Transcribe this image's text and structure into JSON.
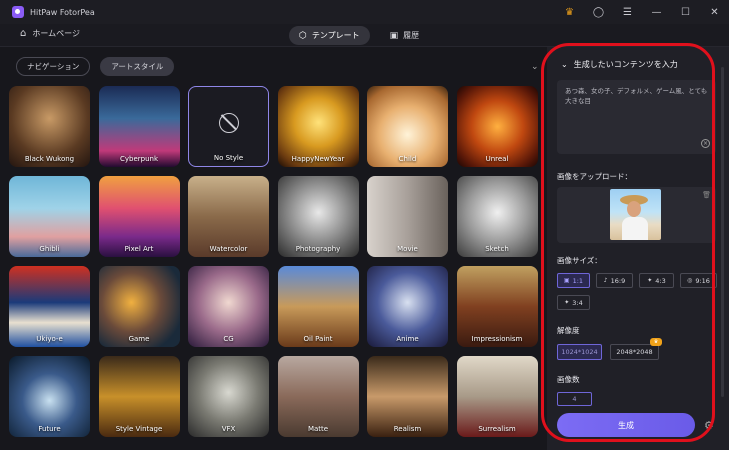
{
  "app": {
    "title": "HitPaw FotorPea"
  },
  "titlebar": {
    "icons": [
      "crown-icon",
      "user-icon",
      "menu-icon",
      "minimize-icon",
      "maximize-icon",
      "close-icon"
    ]
  },
  "nav": {
    "home_label": "ホームページ",
    "tabs": [
      {
        "label": "テンプレート",
        "icon": "cube-icon",
        "active": true
      },
      {
        "label": "履歴",
        "icon": "history-icon",
        "active": false
      }
    ]
  },
  "filters": [
    {
      "label": "ナビゲーション",
      "active": false
    },
    {
      "label": "アートスタイル",
      "active": true
    }
  ],
  "styles": [
    {
      "label": "Black Wukong"
    },
    {
      "label": "Cyberpunk"
    },
    {
      "label": "No Style"
    },
    {
      "label": "HappyNewYear"
    },
    {
      "label": "Child"
    },
    {
      "label": "Unreal"
    },
    {
      "label": "Ghibli"
    },
    {
      "label": "Pixel Art"
    },
    {
      "label": "Watercolor"
    },
    {
      "label": "Photography"
    },
    {
      "label": "Movie"
    },
    {
      "label": "Sketch"
    },
    {
      "label": "Ukiyo-e"
    },
    {
      "label": "Game"
    },
    {
      "label": "CG"
    },
    {
      "label": "Oil Paint"
    },
    {
      "label": "Anime"
    },
    {
      "label": "Impressionism"
    },
    {
      "label": "Future"
    },
    {
      "label": "Style Vintage"
    },
    {
      "label": "VFX"
    },
    {
      "label": "Matte"
    },
    {
      "label": "Realism"
    },
    {
      "label": "Surrealism"
    }
  ],
  "panel": {
    "header": "生成したいコンテンツを入力",
    "prompt_text": "あつ森、女の子、デフォルメ、ゲーム風、とても大きな目",
    "upload_label": "画像をアップロード：",
    "size_label": "画像サイズ：",
    "sizes": [
      {
        "label": "1:1",
        "active": true
      },
      {
        "label": "16:9",
        "active": false
      },
      {
        "label": "4:3",
        "active": false
      },
      {
        "label": "9:16",
        "active": false
      },
      {
        "label": "3:4",
        "active": false
      }
    ],
    "resolution_label": "解像度",
    "resolutions": [
      {
        "label": "1024*1024",
        "active": true
      },
      {
        "label": "2048*2048",
        "active": false,
        "badge": "VIP"
      }
    ],
    "count_label": "画像数",
    "count_value": "4",
    "generate_label": "生成"
  },
  "colors": {
    "accent": "#7c6cf4",
    "highlight": "#e0101c",
    "background": "#17171c"
  }
}
